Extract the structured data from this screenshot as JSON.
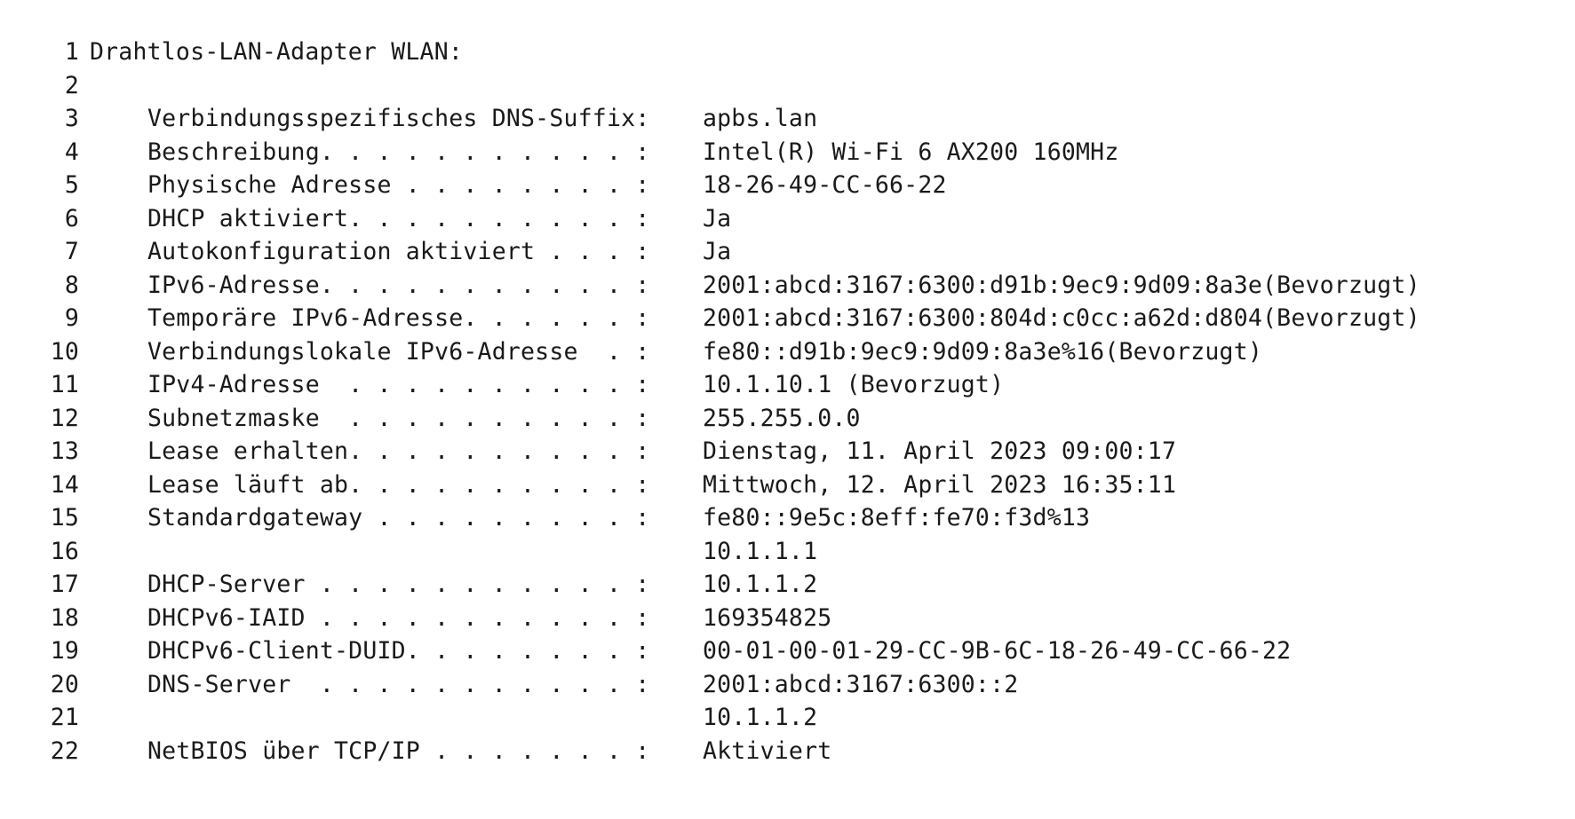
{
  "document": {
    "title_line": {
      "num": "1",
      "text": "Drahtlos-LAN-Adapter WLAN:"
    },
    "blank_line": {
      "num": "2"
    },
    "rows": [
      {
        "num": "3",
        "label": "Verbindungsspezifisches DNS-Suffix:",
        "value": "apbs.lan"
      },
      {
        "num": "4",
        "label": "Beschreibung. . . . . . . . . . . :",
        "value": "Intel(R) Wi-Fi 6 AX200 160MHz"
      },
      {
        "num": "5",
        "label": "Physische Adresse . . . . . . . . :",
        "value": "18-26-49-CC-66-22"
      },
      {
        "num": "6",
        "label": "DHCP aktiviert. . . . . . . . . . :",
        "value": "Ja"
      },
      {
        "num": "7",
        "label": "Autokonfiguration aktiviert . . . :",
        "value": "Ja"
      },
      {
        "num": "8",
        "label": "IPv6-Adresse. . . . . . . . . . . :",
        "value": "2001:abcd:3167:6300:d91b:9ec9:9d09:8a3e(Bevorzugt)"
      },
      {
        "num": "9",
        "label": "Temporäre IPv6-Adresse. . . . . . :",
        "value": "2001:abcd:3167:6300:804d:c0cc:a62d:d804(Bevorzugt)"
      },
      {
        "num": "10",
        "label": "Verbindungslokale IPv6-Adresse  . :",
        "value": "fe80::d91b:9ec9:9d09:8a3e%16(Bevorzugt)"
      },
      {
        "num": "11",
        "label": "IPv4-Adresse  . . . . . . . . . . :",
        "value": "10.1.10.1 (Bevorzugt)"
      },
      {
        "num": "12",
        "label": "Subnetzmaske  . . . . . . . . . . :",
        "value": "255.255.0.0"
      },
      {
        "num": "13",
        "label": "Lease erhalten. . . . . . . . . . :",
        "value": "Dienstag, 11. April 2023 09:00:17"
      },
      {
        "num": "14",
        "label": "Lease läuft ab. . . . . . . . . . :",
        "value": "Mittwoch, 12. April 2023 16:35:11"
      },
      {
        "num": "15",
        "label": "Standardgateway . . . . . . . . . :",
        "value": "fe80::9e5c:8eff:fe70:f3d%13"
      },
      {
        "num": "16",
        "label": "",
        "value": "10.1.1.1"
      },
      {
        "num": "17",
        "label": "DHCP-Server . . . . . . . . . . . :",
        "value": "10.1.1.2"
      },
      {
        "num": "18",
        "label": "DHCPv6-IAID . . . . . . . . . . . :",
        "value": "169354825"
      },
      {
        "num": "19",
        "label": "DHCPv6-Client-DUID. . . . . . . . :",
        "value": "00-01-00-01-29-CC-9B-6C-18-26-49-CC-66-22"
      },
      {
        "num": "20",
        "label": "DNS-Server  . . . . . . . . . . . :",
        "value": "2001:abcd:3167:6300::2"
      },
      {
        "num": "21",
        "label": "",
        "value": "10.1.1.2"
      },
      {
        "num": "22",
        "label": "NetBIOS über TCP/IP . . . . . . . :",
        "value": "Aktiviert"
      }
    ]
  }
}
